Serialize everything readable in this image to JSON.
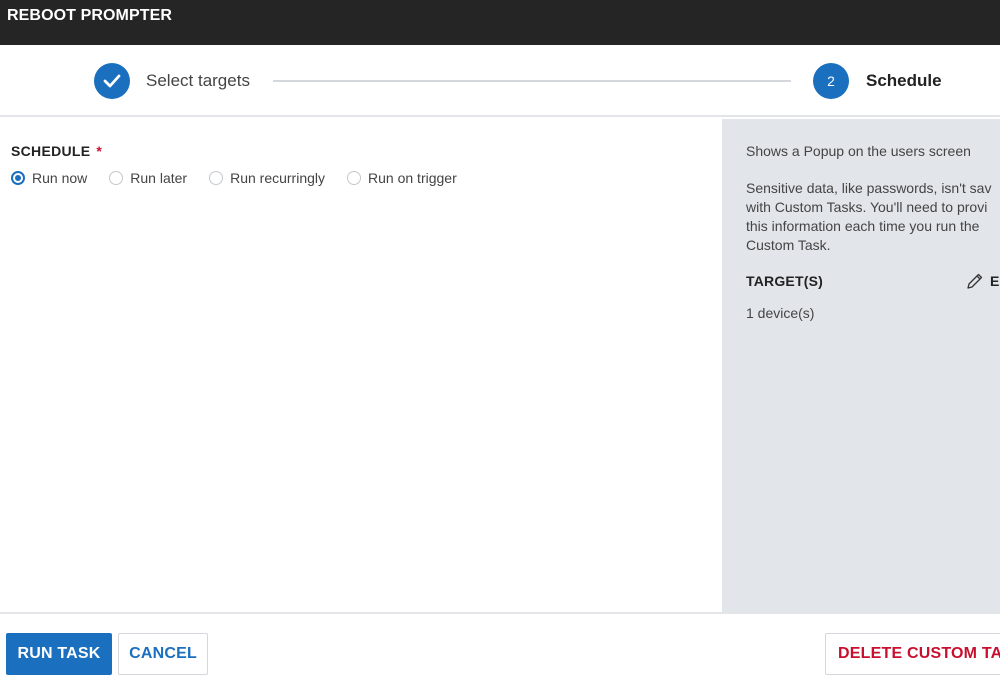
{
  "window": {
    "title": "REBOOT PROMPTER"
  },
  "stepper": {
    "steps": [
      {
        "label": "Select targets",
        "state": "complete",
        "icon": "check-icon"
      },
      {
        "number": "2",
        "label": "Schedule",
        "state": "active"
      }
    ]
  },
  "schedule": {
    "title": "SCHEDULE",
    "required_mark": "*",
    "options": [
      {
        "label": "Run now",
        "selected": true
      },
      {
        "label": "Run later",
        "selected": false
      },
      {
        "label": "Run recurringly",
        "selected": false
      },
      {
        "label": "Run on trigger",
        "selected": false
      }
    ]
  },
  "side_panel": {
    "description": "Shows a Popup on the users screen",
    "note_lines": [
      "Sensitive data, like passwords, isn't sav",
      "with Custom Tasks. You'll need to provi",
      "this information each time you run the",
      "Custom Task."
    ],
    "targets_title": "TARGET(S)",
    "edit_label": "E",
    "edit_icon": "pencil-icon",
    "devices": "1 device(s)"
  },
  "footer": {
    "run_label": "RUN TASK",
    "cancel_label": "CANCEL",
    "delete_label": "DELETE CUSTOM TAS"
  },
  "colors": {
    "accent": "#1a6fbf",
    "danger": "#c8102e",
    "header_bg": "#252525",
    "side_bg": "#e2e6ea"
  }
}
